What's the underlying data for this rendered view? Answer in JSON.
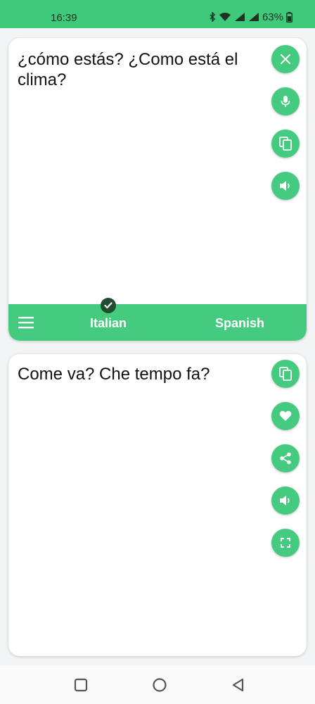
{
  "status_bar": {
    "time": "16:39",
    "battery": "63%",
    "icons": [
      "bluetooth-icon",
      "wifi-icon",
      "signal-icon",
      "signal-icon",
      "battery-icon"
    ]
  },
  "source": {
    "text": "¿cómo estás? ¿Como está el clima?",
    "actions": [
      "close-icon",
      "microphone-icon",
      "copy-icon",
      "speaker-icon"
    ]
  },
  "language_bar": {
    "source_language": "Italian",
    "target_language": "Spanish",
    "menu_icon": "menu-icon",
    "selected_indicator": "check-icon"
  },
  "translation": {
    "text": "Come va? Che tempo fa?",
    "actions": [
      "copy-icon",
      "heart-icon",
      "share-icon",
      "speaker-icon",
      "fullscreen-icon"
    ]
  },
  "navigation": {
    "buttons": [
      "recents-icon",
      "home-icon",
      "back-icon"
    ]
  },
  "colors": {
    "accent": "#45cb80",
    "status_bar": "#3fc97a",
    "check_badge": "#1f4d2e"
  }
}
